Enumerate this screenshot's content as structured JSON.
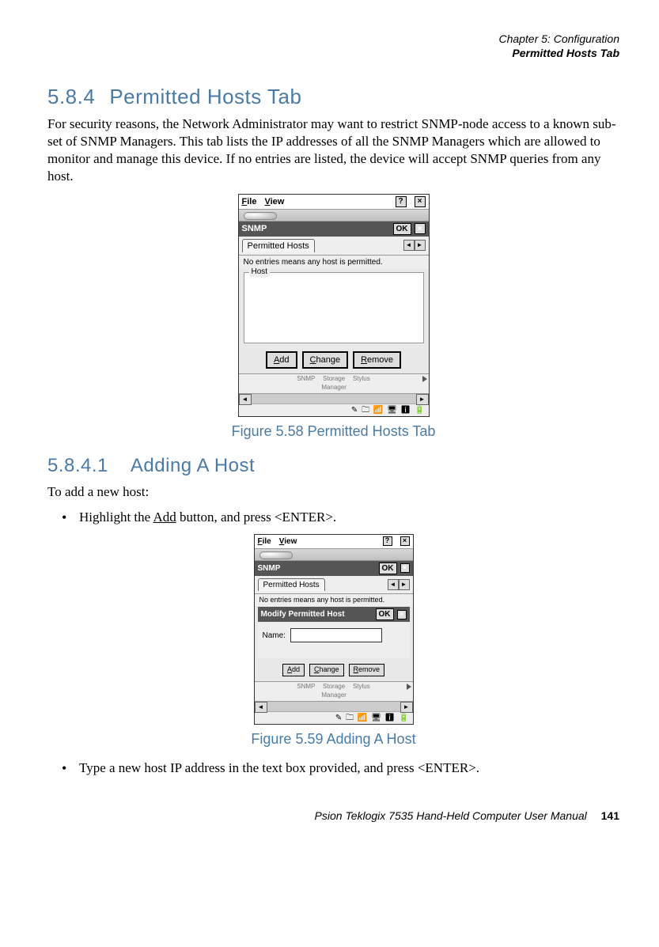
{
  "header": {
    "chapter": "Chapter 5: Configuration",
    "section": "Permitted Hosts Tab"
  },
  "h_584": {
    "num": "5.8.4",
    "title": "Permitted Hosts Tab"
  },
  "para1": "For security reasons, the Network Administrator may want to restrict SNMP-node access to a known sub-set of SNMP Managers. This tab lists the IP addresses of all the SNMP Managers which are allowed to monitor and manage this device. If no entries are listed, the device will accept SNMP queries from any host.",
  "fig58": "Figure 5.58 Permitted Hosts Tab",
  "h_5841": {
    "num": "5.8.4.1",
    "title": "Adding A Host"
  },
  "para2": "To add a new host:",
  "bullet1_pre": "Highlight the ",
  "bullet1_link": "Add",
  "bullet1_post": " button, and press <ENTER>.",
  "fig59": "Figure 5.59 Adding A Host",
  "bullet2": "Type a new host IP address in the text box provided, and press <ENTER>.",
  "footer": {
    "title": "Psion Teklogix 7535 Hand-Held Computer User Manual",
    "page": "141"
  },
  "win": {
    "menu_file": "File",
    "menu_view": "View",
    "help": "?",
    "close": "×",
    "title_snmp": "SNMP",
    "ok": "OK",
    "tab_permitted": "Permitted Hosts",
    "note": "No entries means any host is permitted.",
    "legend_host": "Host",
    "btn_add": "Add",
    "btn_change": "Change",
    "btn_remove": "Remove",
    "icon_snmp": "SNMP",
    "icon_storage": "Storage Manager",
    "icon_stylus": "Stylus",
    "title_modify": "Modify Permitted Host",
    "label_name": "Name:",
    "arrow_left": "◄",
    "arrow_right": "►",
    "arrow_up": "▲",
    "arrow_down": "▼",
    "tray": "✎ 🗀 📶 🖥 ℹ 🔋"
  }
}
